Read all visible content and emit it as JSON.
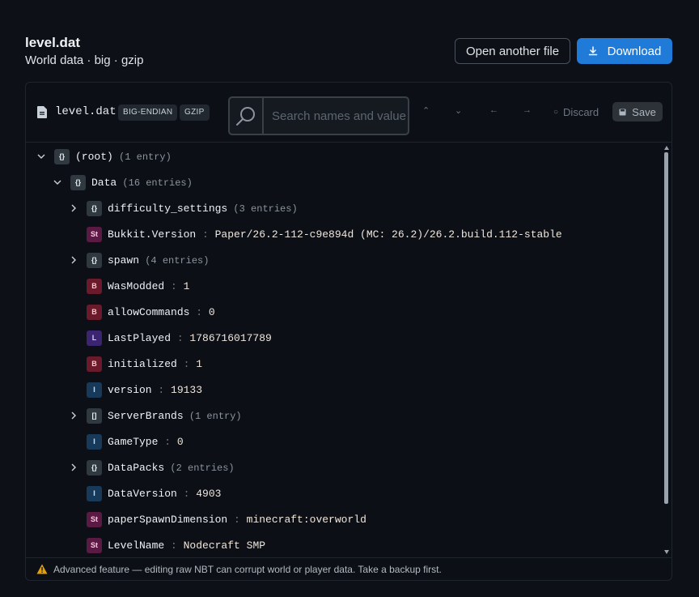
{
  "header": {
    "title": "level.dat",
    "subtitle": "World data · big · gzip",
    "open_label": "Open another file",
    "download_label": "Download"
  },
  "toolbar": {
    "file_name": "level.dat",
    "tags": [
      "BIG-ENDIAN",
      "GZIP"
    ],
    "search_placeholder": "Search names and value",
    "discard_label": "Discard",
    "save_label": "Save"
  },
  "tree": [
    {
      "depth": 0,
      "type": "compound",
      "badge": "{}",
      "name": "(root)",
      "meta": "(1 entry)",
      "expand": "open"
    },
    {
      "depth": 1,
      "type": "compound",
      "badge": "{}",
      "name": "Data",
      "meta": "(16 entries)",
      "expand": "open"
    },
    {
      "depth": 2,
      "type": "compound",
      "badge": "{}",
      "name": "difficulty_settings",
      "meta": "(3 entries)",
      "expand": "closed"
    },
    {
      "depth": 2,
      "type": "string",
      "badge": "St",
      "name": "Bukkit.Version",
      "value": "Paper/26.2-112-c9e894d (MC: 26.2)/26.2.build.112-stable"
    },
    {
      "depth": 2,
      "type": "compound",
      "badge": "{}",
      "name": "spawn",
      "meta": "(4 entries)",
      "expand": "closed"
    },
    {
      "depth": 2,
      "type": "byte",
      "badge": "B",
      "name": "WasModded",
      "value": "1"
    },
    {
      "depth": 2,
      "type": "byte",
      "badge": "B",
      "name": "allowCommands",
      "value": "0"
    },
    {
      "depth": 2,
      "type": "long",
      "badge": "L",
      "name": "LastPlayed",
      "value": "1786716017789"
    },
    {
      "depth": 2,
      "type": "byte",
      "badge": "B",
      "name": "initialized",
      "value": "1"
    },
    {
      "depth": 2,
      "type": "int",
      "badge": "I",
      "name": "version",
      "value": "19133"
    },
    {
      "depth": 2,
      "type": "list",
      "badge": "[]",
      "name": "ServerBrands",
      "meta": "(1 entry)",
      "expand": "closed"
    },
    {
      "depth": 2,
      "type": "int",
      "badge": "I",
      "name": "GameType",
      "value": "0"
    },
    {
      "depth": 2,
      "type": "compound",
      "badge": "{}",
      "name": "DataPacks",
      "meta": "(2 entries)",
      "expand": "closed"
    },
    {
      "depth": 2,
      "type": "int",
      "badge": "I",
      "name": "DataVersion",
      "value": "4903"
    },
    {
      "depth": 2,
      "type": "string",
      "badge": "St",
      "name": "paperSpawnDimension",
      "value": "minecraft:overworld"
    },
    {
      "depth": 2,
      "type": "string",
      "badge": "St",
      "name": "LevelName",
      "value": "Nodecraft SMP"
    }
  ],
  "footer": {
    "warning": "Advanced feature — editing raw NBT can corrupt world or player data. Take a backup first.",
    "icon": "warning-icon"
  }
}
